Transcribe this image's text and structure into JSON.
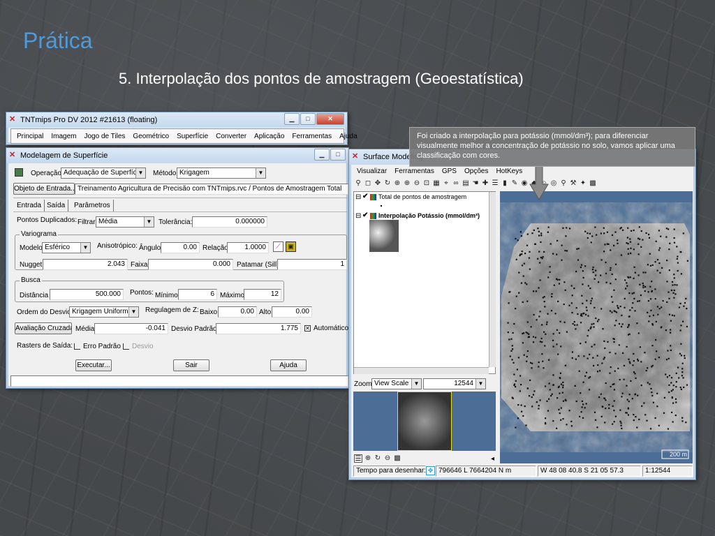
{
  "slide": {
    "title": "Prática",
    "subtitle": "5. Interpolação dos pontos de amostragem (Geoestatística)"
  },
  "main_window": {
    "title": "TNTmips Pro DV 2012  #21613 (floating)",
    "menu": [
      "Principal",
      "Imagem",
      "Jogo de Tiles",
      "Geométrico",
      "Superfície",
      "Converter",
      "Aplicação",
      "Ferramentas",
      "Ajuda"
    ]
  },
  "modelagem": {
    "title": "Modelagem de Superfície",
    "operacao_label": "Operação",
    "operacao_value": "Adequação de Superfície",
    "metodo_label": "Método",
    "metodo_value": "Krigagem",
    "objeto_button": "Objeto de Entrada...",
    "objeto_value": "Treinamento Agricultura de Precisão com TNTmips.rvc / Pontos de Amostragem Total",
    "tabs": [
      "Entrada",
      "Saída",
      "Parâmetros"
    ],
    "pontos_duplicados_label": "Pontos Duplicados:",
    "filtrar_label": "Filtrar",
    "filtrar_value": "Média",
    "tolerancia_label": "Tolerância:",
    "tolerancia_value": "0.000000",
    "variograma_label": "Variograma",
    "modelo_label": "Modelo",
    "modelo_value": "Esférico",
    "anisotropico_label": "Anisotrópico:",
    "angulo_label": "Ângulo",
    "angulo_value": "0.00",
    "relacao_label": "Relação",
    "relacao_value": "1.0000",
    "nugget_label": "Nugget",
    "nugget_value": "2.043",
    "faixa_label": "Faixa",
    "faixa_value": "0.000",
    "patamar_label": "Patamar (Sill)",
    "patamar_value": "1",
    "busca_label": "Busca",
    "distancia_label": "Distância",
    "distancia_value": "500.000",
    "pontos_label": "Pontos:",
    "minimo_label": "Mínimo",
    "minimo_value": "6",
    "maximo_label": "Máximo",
    "maximo_value": "12",
    "ordem_label": "Ordem do Desvio",
    "ordem_value": "Krigagem Uniforme",
    "regulagem_label": "Regulagem de Z:",
    "baixo_label": "Baixo",
    "baixo_value": "0.00",
    "alto_label": "Alto",
    "alto_value": "0.00",
    "avaliacao_button": "Avaliação Cruzada",
    "media_label": "Média",
    "media_value": "-0.041",
    "desvio_padrao_label": "Desvio Padrão",
    "desvio_padrao_value": "1.775",
    "automatico_label": "Automático",
    "rasters_label": "Rasters de Saída:",
    "erro_padrao_label": "Erro Padrão",
    "desvio_label": "Desvio",
    "executar_button": "Executar...",
    "sair_button": "Sair",
    "ajuda_button": "Ajuda"
  },
  "surface_window": {
    "title": "Surface Modeling",
    "menu": [
      "Visualizar",
      "Ferramentas",
      "GPS",
      "Opções",
      "HotKeys"
    ],
    "layer1": "Total de pontos de amostragem",
    "layer2": "Interpolação Potássio (mmol/dm³)",
    "zoom_label": "Zoom",
    "zoom_mode": "View Scale",
    "zoom_value": "12544",
    "scale_bar": "200 m",
    "status_tempo": "Tempo para desenhar: 0",
    "status_coords": "796646 L  7664204 N m",
    "status_latlon": "W 48 08 40.8  S 21 05 57.3",
    "status_scale": "1:12544"
  },
  "callout_text": "Foi criado a interpolação para potássio (mmol/dm³); para diferenciar visualmente melhor a concentração de potássio no solo, vamos aplicar uma classificação com cores.",
  "colors": {
    "title_blue": "#4f9ad8",
    "map_blue": "#4c6e96"
  }
}
